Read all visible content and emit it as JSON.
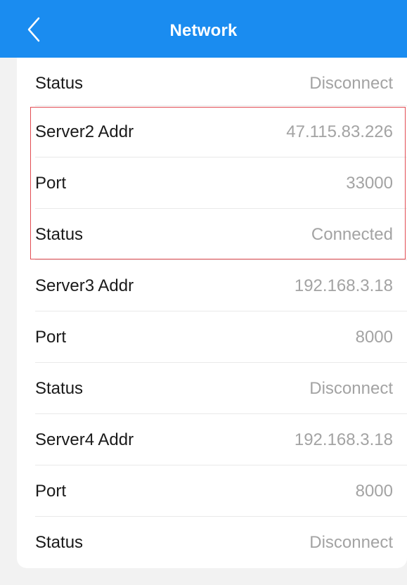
{
  "header": {
    "title": "Network",
    "back_icon": "chevron-left-icon",
    "background_color": "#1a8cf0"
  },
  "rows": [
    {
      "label": "Status",
      "value": "Disconnect"
    },
    {
      "label": "Server2 Addr",
      "value": "47.115.83.226"
    },
    {
      "label": "Port",
      "value": "33000"
    },
    {
      "label": "Status",
      "value": "Connected"
    },
    {
      "label": "Server3 Addr",
      "value": "192.168.3.18"
    },
    {
      "label": "Port",
      "value": "8000"
    },
    {
      "label": "Status",
      "value": "Disconnect"
    },
    {
      "label": "Server4 Addr",
      "value": "192.168.3.18"
    },
    {
      "label": "Port",
      "value": "8000"
    },
    {
      "label": "Status",
      "value": "Disconnect"
    }
  ],
  "highlight": {
    "color": "#e24b52"
  }
}
